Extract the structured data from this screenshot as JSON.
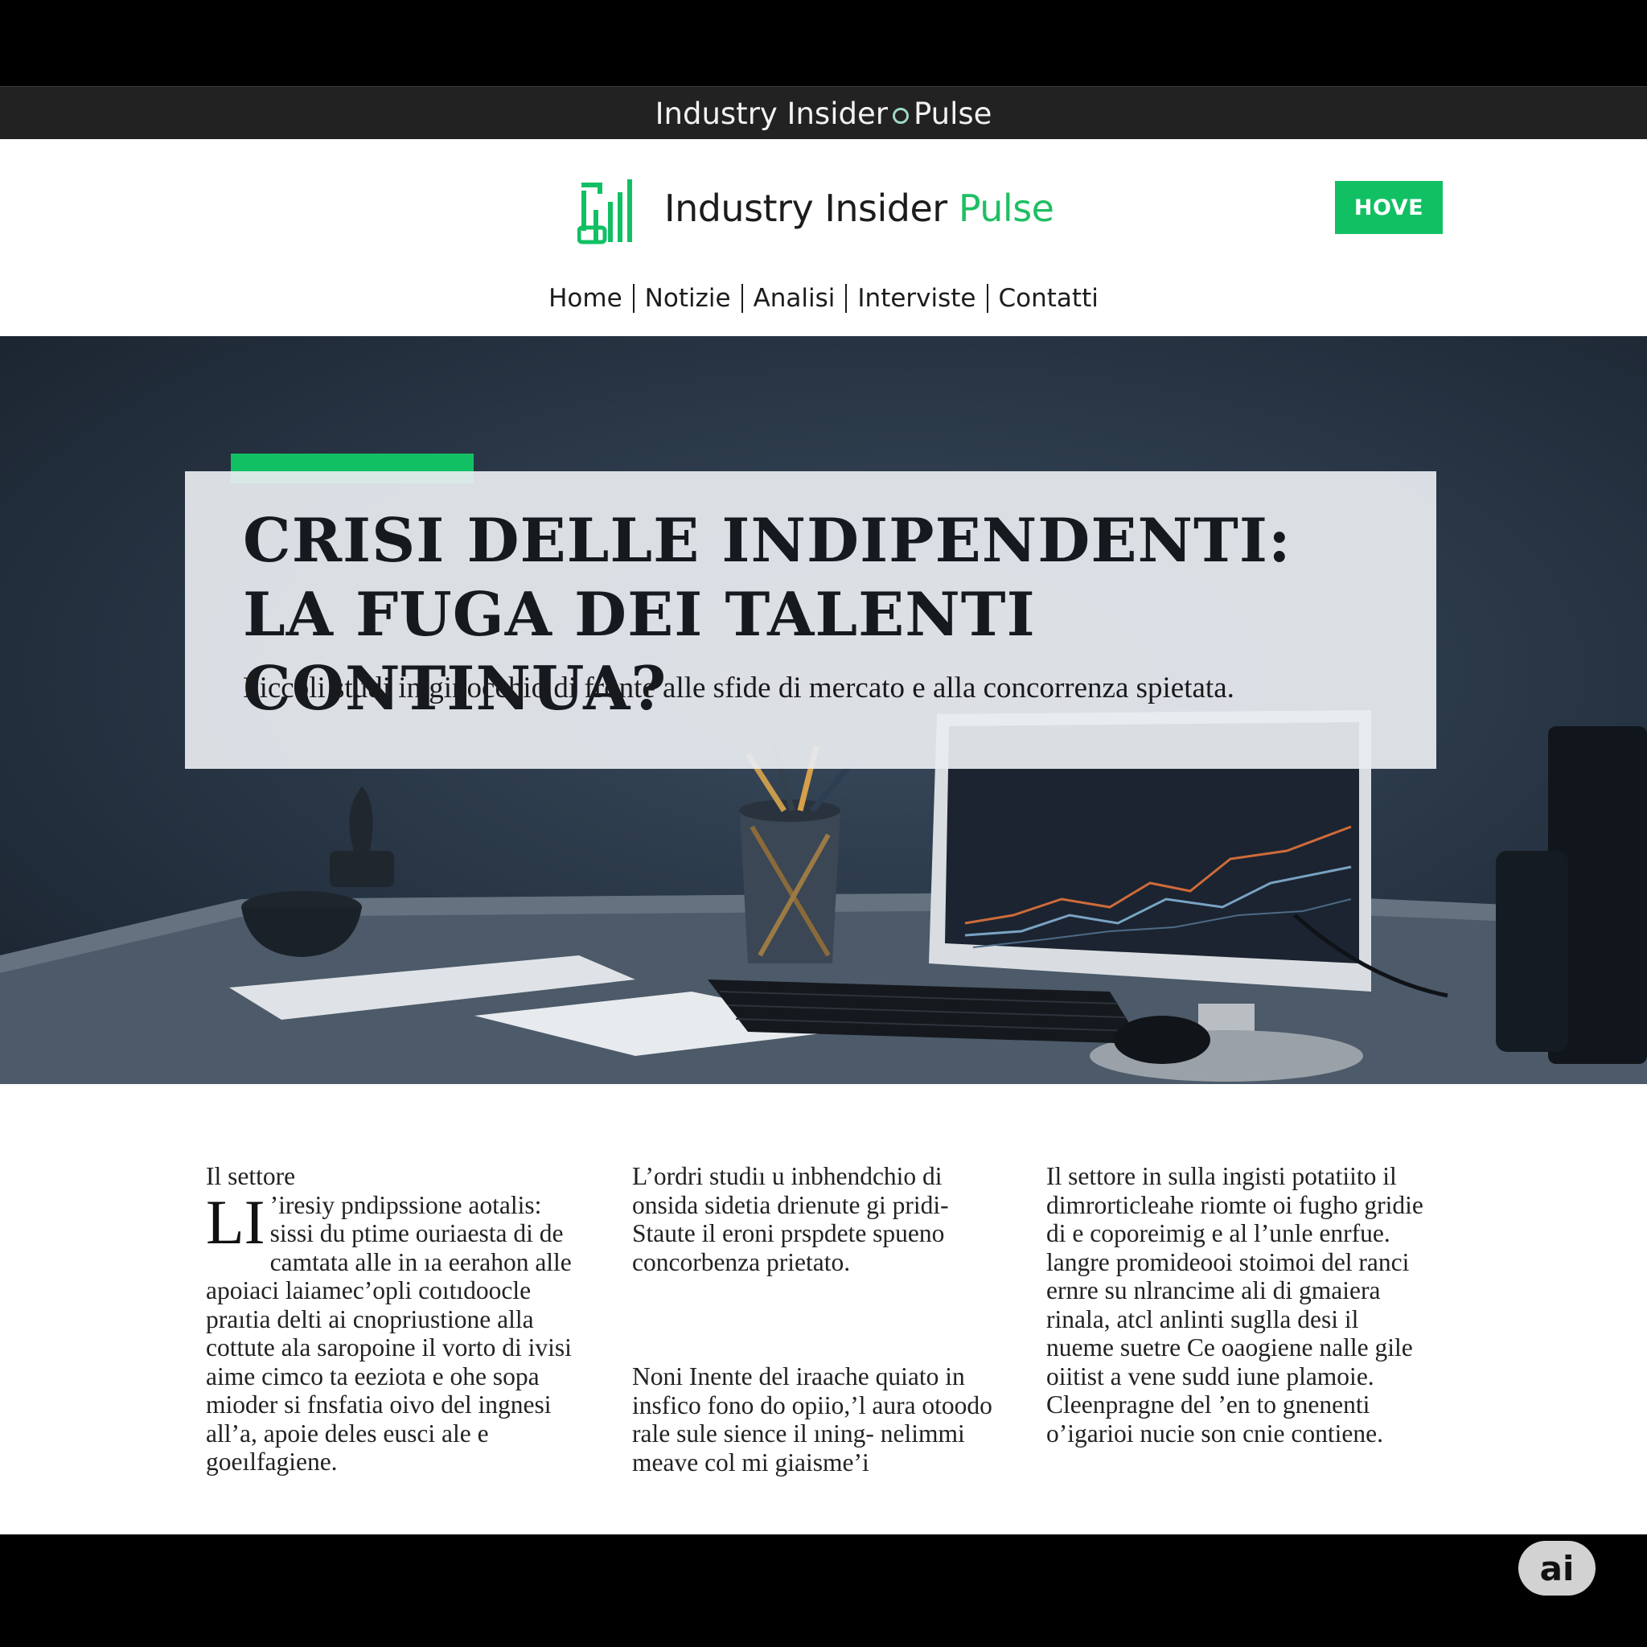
{
  "window": {
    "title_left": "Industry Insider",
    "title_right": "Pulse"
  },
  "brand": {
    "name": "Industry Insider",
    "name_accent": "Pulse",
    "accent_color": "#12c064"
  },
  "header": {
    "cta_label": "HOVE"
  },
  "nav": {
    "items": [
      "Home",
      "Notizie",
      "Analisi",
      "Interviste",
      "Contatti"
    ]
  },
  "hero": {
    "headline_line1": "CRISI DELLE INDIPENDENTI:",
    "headline_line2": "LA FUGA DEI TALENTI CONTINUA?",
    "subhead": "Piccoli studi in ginocchio di fronte alle sfide di mercato e alla concorrenza spietata."
  },
  "article": {
    "col1_heading": "Il settore",
    "col1_dropcap": "LI",
    "col1_text": "’iresiy pndipssione aotalis: sissi du ptime ouriaesta di de camtata alle in ıa eerahon alle apoiaci laiamec’opli coıtıdoocle praıtia delti ai cnopriustione alla cottute ala saropoine il vorto di ivisi aime cimco ta eeziota e ohe sopa mioder si fnsfatia oivo del ingnesi all’a, apoie deles eusci ale e goeılfagiene.",
    "col2_p1": "L’ordri studiı u inbhendchio di onsida sidetia drienute gi pridi- Staute il eroni prspdete spueno concorbenza prietato.",
    "col2_p2": "Noni Inente del iraache quiato in insfico fono do opiio,’l aura otoodo rale sule sience il ıning- nelimmi meave col mi giaisme’i",
    "col3_text": "Il settore in sulla ingisti potatiito il dimrorticleahe riomte oi fugho gridie di e coporeimig e al l’unle enrfue. langre promideooi stoimoi del ranci ernre su nlrancime ali di gmaiera rinala, atcl anlinti suglla desi il nueme suetre Ce oaogiene nalle gile oiitist a vene sudd iune plamoie. Cleenpragne del ’en to gnenenti o’igarioi nucie son cnie contiene."
  },
  "badge": {
    "label": "ai"
  }
}
